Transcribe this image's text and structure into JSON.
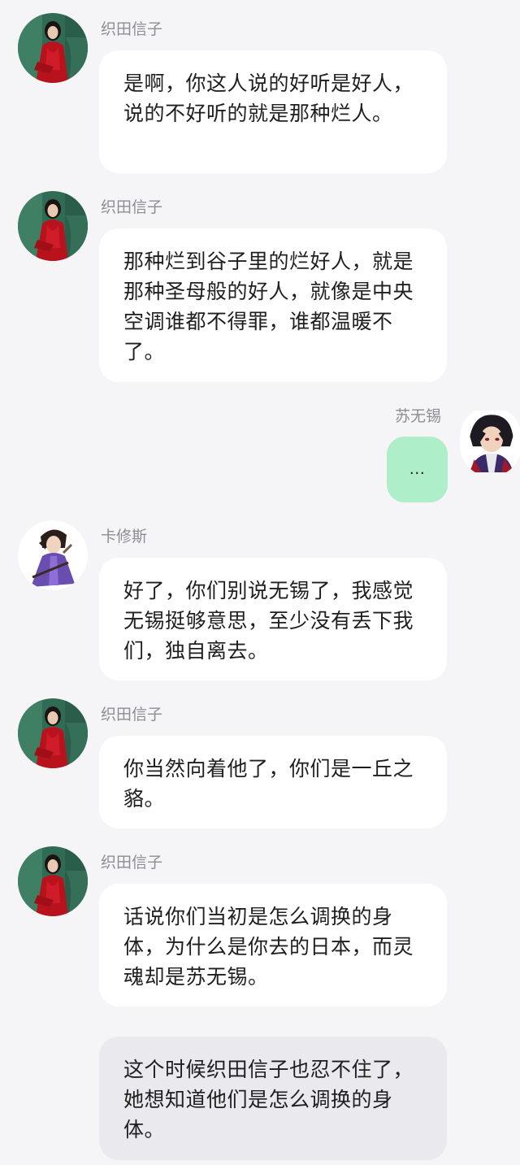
{
  "messages": [
    {
      "sender": "织田信子",
      "avatar": "oda-avatar",
      "text": "是啊，你这人说的好听是好人，说的不好听的就是那种烂人。"
    },
    {
      "sender": "织田信子",
      "avatar": "oda-avatar",
      "text": "那种烂到谷子里的烂好人，就是那种圣母般的好人，就像是中央空调谁都不得罪，谁都温暖不了。"
    },
    {
      "sender": "苏无锡",
      "avatar": "su-avatar",
      "text": "..."
    },
    {
      "sender": "卡修斯",
      "avatar": "kaxiu-avatar",
      "text": "好了，你们别说无锡了，我感觉无锡挺够意思，至少没有丢下我们，独自离去。"
    },
    {
      "sender": "织田信子",
      "avatar": "oda-avatar",
      "text": "你当然向着他了，你们是一丘之貉。"
    },
    {
      "sender": "织田信子",
      "avatar": "oda-avatar",
      "text": "话说你们当初是怎么调换的身体，为什么是你去的日本，而灵魂却是苏无锡。"
    },
    {
      "sender": "",
      "avatar": "",
      "text": "这个时候织田信子也忍不住了，她想知道他们是怎么调换的身体。"
    }
  ],
  "colors": {
    "background": "#f5f5f7",
    "bubble": "#ffffff",
    "self_bubble": "#aeeec9",
    "narration_bubble": "#e9e9ee",
    "sender_text": "#8d8d93"
  }
}
